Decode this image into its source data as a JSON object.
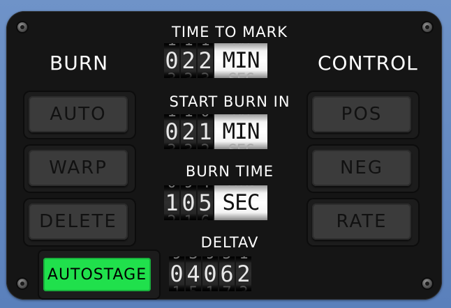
{
  "panel": {
    "left_title": "BURN",
    "right_title": "CONTROL"
  },
  "left_buttons": [
    {
      "label": "AUTO"
    },
    {
      "label": "WARP"
    },
    {
      "label": "DELETE"
    }
  ],
  "right_buttons": [
    {
      "label": "POS"
    },
    {
      "label": "NEG"
    },
    {
      "label": "RATE"
    }
  ],
  "autostage": {
    "label": "AUTOSTAGE",
    "color": "#20e04c"
  },
  "readouts": {
    "time_to_mark": {
      "label": "TIME TO MARK",
      "digits": [
        "0",
        "2",
        "2"
      ],
      "unit": "MIN"
    },
    "start_burn_in": {
      "label": "START BURN IN",
      "digits": [
        "0",
        "2",
        "1"
      ],
      "unit": "MIN"
    },
    "burn_time": {
      "label": "BURN TIME",
      "digits": [
        "1",
        "0",
        "5"
      ],
      "unit": "SEC"
    },
    "deltav": {
      "label": "DELTAV",
      "digits": [
        "0",
        "4",
        "0",
        "6",
        "2"
      ]
    }
  },
  "icons": [
    "screw-icon"
  ]
}
